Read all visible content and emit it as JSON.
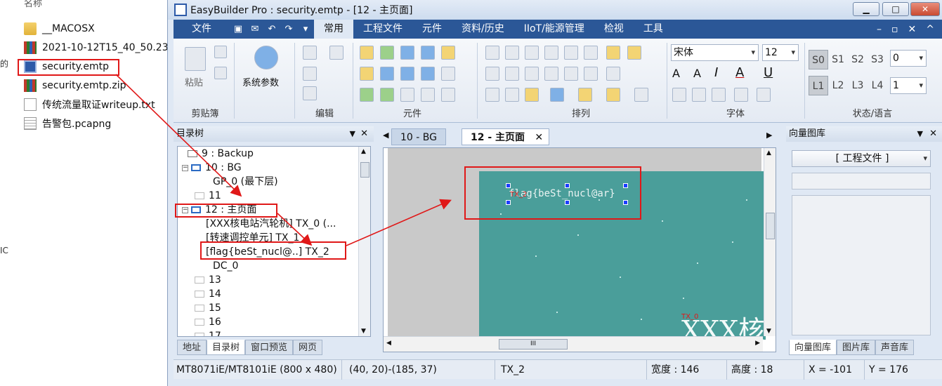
{
  "explorer": {
    "header": "名称",
    "items": [
      {
        "name": "__MACOSX",
        "icon": "folder-icon"
      },
      {
        "name": "2021-10-12T15_40_50.23",
        "icon": "archive-icon"
      },
      {
        "name": "security.emtp",
        "icon": "app-file-icon"
      },
      {
        "name": "security.emtp.zip",
        "icon": "archive-icon"
      },
      {
        "name": "传统流量取证writeup.txt",
        "icon": "text-file-icon"
      },
      {
        "name": "告警包.pcapng",
        "icon": "pcap-file-icon"
      }
    ],
    "edge_chars": [
      "的",
      "IC"
    ]
  },
  "window": {
    "title": "EasyBuilder Pro : security.emtp - [12 - 主页面]",
    "buttons": {
      "minimize": "▁",
      "maximize": "□",
      "close": "✕"
    }
  },
  "menu": {
    "file": "文件",
    "tabs": [
      "常用",
      "工程文件",
      "元件",
      "资料/历史",
      "IIoT/能源管理",
      "检视",
      "工具"
    ],
    "active": "常用",
    "right_controls": [
      "–",
      "▫",
      "✕",
      "^"
    ]
  },
  "ribbon": {
    "clipboard": {
      "paste": "粘贴",
      "label": "剪贴簿"
    },
    "params": {
      "label": "系统参数"
    },
    "edit": {
      "label": "编辑"
    },
    "components": {
      "label": "元件"
    },
    "arrange": {
      "label": "排列"
    },
    "font": {
      "name": "宋体",
      "size": "12",
      "label": "字体"
    },
    "state": {
      "label": "状态/语言",
      "states": [
        "S0",
        "S1",
        "S2",
        "S3"
      ],
      "langs": [
        "L1",
        "L2",
        "L3",
        "L4"
      ],
      "state_value": "0",
      "lang_value": "1"
    }
  },
  "tree_panel": {
    "title": "目录树",
    "rows": [
      "9 : Backup",
      "10 : BG",
      "GP_0 (最下层)",
      "11",
      "12 : 主页面",
      "[XXX核电站汽轮机] TX_0 (...",
      "[转速调控单元] TX_1",
      "[flag{beSt_nucl@..] TX_2",
      "DC_0",
      "13",
      "14",
      "15",
      "16",
      "17"
    ],
    "bottom_tabs": [
      "地址",
      "目录树",
      "窗口预览",
      "网页"
    ],
    "active_tab": "目录树"
  },
  "editor": {
    "tabs": [
      "10 - BG",
      "12 - 主页面"
    ],
    "active_tab": "12 - 主页面",
    "tab_close": "✕",
    "canvas": {
      "selected_text": "{beSt_nucl@ar}",
      "flag_prefix": "flag",
      "tx_label_1": "TX_2",
      "tx_label_2": "TX_0",
      "big_text": "XXX核电"
    },
    "hscroll_grip": "III"
  },
  "lib_panel": {
    "title": "向量图库",
    "dropdown": "[ 工程文件 ]",
    "bottom_tabs": [
      "向量图库",
      "图片库",
      "声音库"
    ],
    "active_tab": "向量图库"
  },
  "statusbar": {
    "model": "MT8071iE/MT8101iE (800 x 480)",
    "coords": "(40, 20)-(185, 37)",
    "object": "TX_2",
    "width": "宽度 : 146",
    "height": "高度 :  18",
    "x": "X = -101",
    "y": "Y = 176"
  },
  "colors": {
    "menubar": "#2b5797",
    "screen": "#4a9e9a",
    "annotation": "#e01818",
    "handle": "#1a3cff"
  }
}
